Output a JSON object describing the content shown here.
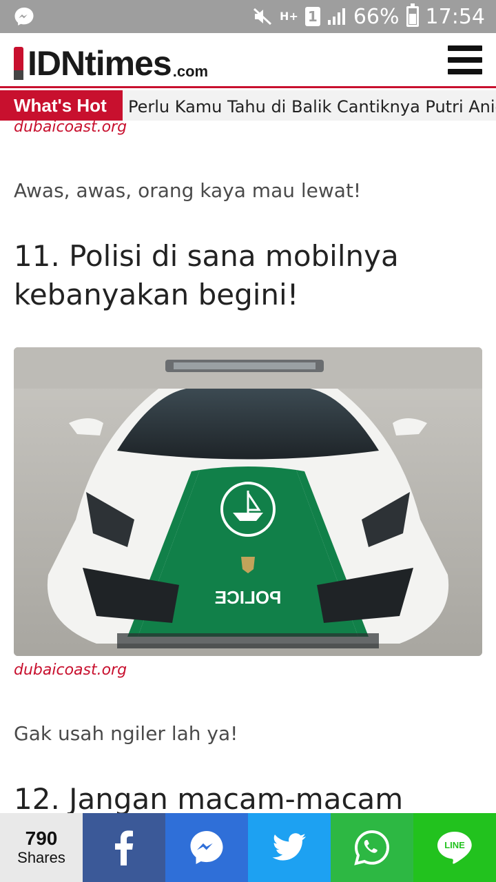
{
  "status_bar": {
    "network": "H+",
    "sim": "1",
    "battery": "66%",
    "battery_level": 0.66,
    "time": "17:54"
  },
  "header": {
    "logo_main": "IDNtimes",
    "logo_suffix": ".com"
  },
  "whats_hot": {
    "label": "What's Hot",
    "headline": "Perlu Kamu Tahu di Balik Cantiknya Putri Anie"
  },
  "article": {
    "source_top": "dubaicoast.org",
    "paragraph_1": "Awas, awas, orang kaya mau lewat!",
    "heading_11": "11. Polisi di sana mobilnya kebanyakan begini!",
    "photo_text": "POLICE",
    "source_bottom": "dubaicoast.org",
    "paragraph_2": "Gak usah ngiler lah ya!",
    "heading_12": "12. Jangan macam-macam"
  },
  "share_bar": {
    "count": "790",
    "count_label": "Shares",
    "line_label": "LINE"
  },
  "colors": {
    "brand_red": "#c8102e",
    "facebook": "#3b5998",
    "messenger": "#2f6fd8",
    "twitter": "#1da1f2",
    "whatsapp": "#2db843",
    "line": "#22c21e"
  }
}
